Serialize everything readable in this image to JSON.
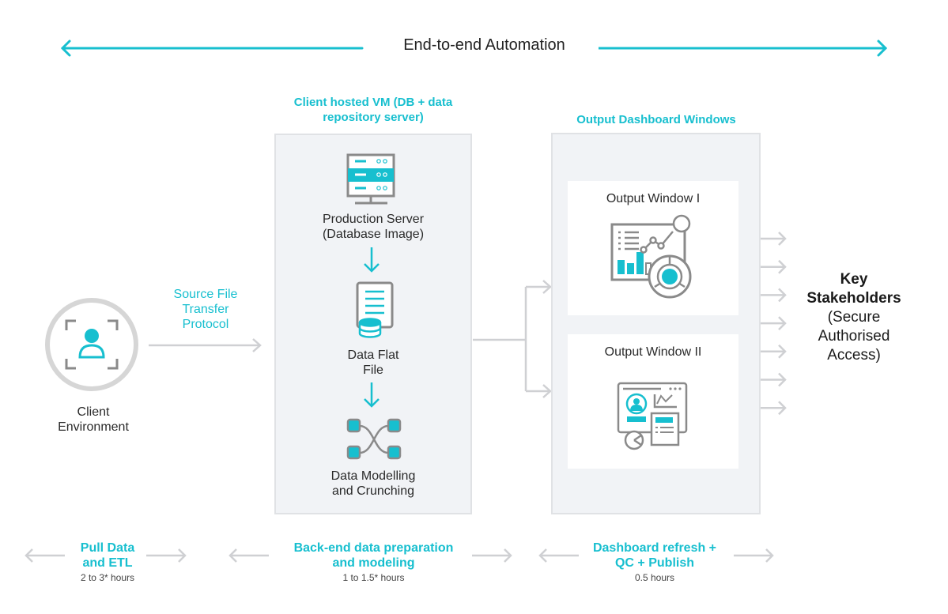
{
  "colors": {
    "accent": "#17bfcf",
    "icon_gray": "#8a8a8a",
    "connector_gray": "#cfd0d3",
    "panel_bg": "#f1f3f6",
    "panel_border": "#e0e2e5"
  },
  "top": {
    "title": "End-to-end Automation"
  },
  "client": {
    "label_line1": "Client",
    "label_line2": "Environment",
    "icon": "user-focus-icon"
  },
  "transfer": {
    "line1": "Source File",
    "line2": "Transfer",
    "line3": "Protocol"
  },
  "vm": {
    "header_line1": "Client hosted VM (DB + data",
    "header_line2": "repository server)",
    "steps": [
      {
        "icon": "server-icon",
        "line1": "Production Server",
        "line2": "(Database Image)"
      },
      {
        "icon": "flat-file-icon",
        "line1": "Data Flat",
        "line2": "File"
      },
      {
        "icon": "data-modelling-icon",
        "line1": "Data Modelling",
        "line2": "and Crunching"
      }
    ]
  },
  "dashboard": {
    "header": "Output Dashboard Windows",
    "windows": [
      {
        "title": "Output Window I",
        "icon": "analytics-dashboard-icon"
      },
      {
        "title": "Output Window II",
        "icon": "profile-dashboard-icon"
      }
    ]
  },
  "stakeholders": {
    "line1": "Key",
    "line2": "Stakeholders",
    "line3": "(Secure",
    "line4": "Authorised",
    "line5": "Access)",
    "arrow_count": 7
  },
  "stages": [
    {
      "title_line1": "Pull Data",
      "title_line2": "and ETL",
      "duration": "2 to 3* hours"
    },
    {
      "title_line1": "Back-end data preparation",
      "title_line2": "and modeling",
      "duration": "1 to 1.5* hours"
    },
    {
      "title_line1": "Dashboard refresh +",
      "title_line2": "QC + Publish",
      "duration": "0.5 hours"
    }
  ]
}
